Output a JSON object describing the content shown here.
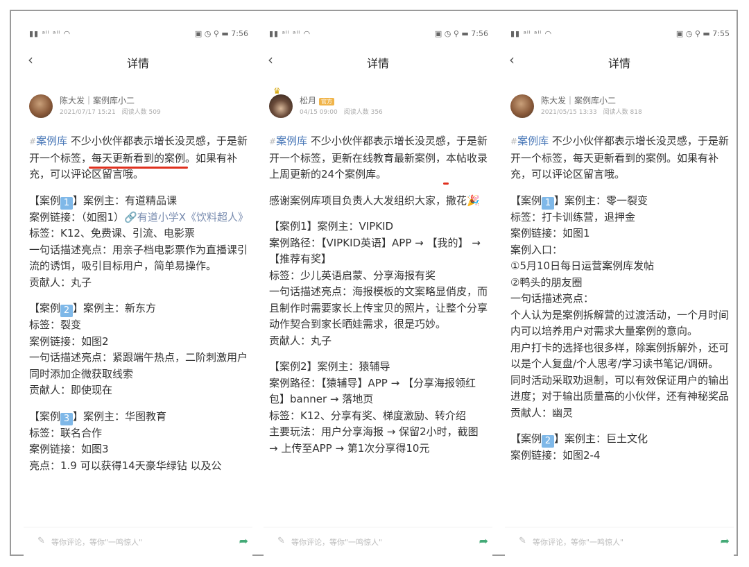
{
  "nav_title": "详情",
  "comment_placeholder": "等你评论，等你\"一鸣惊人\"",
  "panels": [
    {
      "status_time": "7:56",
      "author_name": "陈大发｜案例库小二",
      "author_meta": "2021/07/17 15:21　阅读人数 509",
      "intro_prefix": "案例库",
      "intro_a": "不少小伙伴都表示增长没灵感，",
      "intro_b": "于是新开一个标签，",
      "intro_hl": "每天更新看到的案例",
      "intro_c": "。",
      "intro_d": "如果有补充，可以评论区留言哦。",
      "case1_head": "】案例主：有道精品课",
      "case1_link_label": "案例链接：（如图1）",
      "case1_link": "有道小学X《饮料超人》",
      "case1_tags": "标签：K12、免费课、引流、电影票",
      "case1_desc": "一句话描述亮点：用亲子档电影票作为直播课引流的诱饵，吸引目标用户，简单易操作。",
      "case1_contrib": "贡献人：丸子",
      "case2_head": "】案例主：新东方",
      "case2_tags": "标签：裂变",
      "case2_link": "案例链接：如图2",
      "case2_desc": "一句话描述亮点：紧跟端午热点，二阶刺激用户同时添加企微获取线索",
      "case2_contrib": "贡献人：即使现在",
      "case3_head": "】案例主：华图教育",
      "case3_tags": "标签：联名合作",
      "case3_link": "案例链接：如图3",
      "case3_desc": "亮点：1.9 可以获得14天豪华绿钻 以及公"
    },
    {
      "status_time": "7:56",
      "author_name": "松月",
      "author_tag": "官方",
      "author_meta": "04/15 09:00　阅读人数 356",
      "intro_prefix": "案例库",
      "intro_a": "不少小伙伴都表示增长没灵感，",
      "intro_b": "于是新开一个标签，更新在线教育最新案例，",
      "intro_hl": "本帖收录上周更新的24个案例库",
      "intro_c": "。",
      "thanks": "感谢案例库项目负责人大发组织大家，撒花🎉",
      "case1_head": "【案例1】案例主：VIPKID",
      "case1_path": "案例路径：【VIPKID英语】APP → 【我的】 → 【推荐有奖】",
      "case1_tags": "标签：少儿英语启蒙、分享海报有奖",
      "case1_desc": "一句话描述亮点：海报模板的文案略显俏皮，而且制作时需要家长上传宝贝的照片，让整个分享动作契合到家长晒娃需求，很是巧妙。",
      "case1_contrib": "贡献人：丸子",
      "case2_head": "【案例2】案例主：猿辅导",
      "case2_path": "案例路径：【猿辅导】APP → 【分享海报领红包】banner → 落地页",
      "case2_tags": "标签：K12、分享有奖、梯度激励、转介绍",
      "case2_play": "主要玩法：用户分享海报 → 保留2小时，截图 → 上传至APP → 第1次分享得10元"
    },
    {
      "status_time": "7:55",
      "author_name": "陈大发｜案例库小二",
      "author_meta": "2021/05/15 13:33　阅读人数 818",
      "intro_prefix": "案例库",
      "intro_a": "不少小伙伴都表示增长没灵感，",
      "intro_b": "于是新开一个标签，每天更新看到的案例。",
      "intro_d": "如果有补充，可以评论区留言哦。",
      "case1_head": "】案例主：零一裂变",
      "case1_tags": "标签：打卡训练营，退押金",
      "case1_link": "案例链接：如图1",
      "case1_entry": "案例入口：",
      "case1_e1": "①5月10日每日运营案例库发帖",
      "case1_e2": "②鸭头的朋友圈",
      "case1_desc_head": "一句话描述亮点：",
      "case1_desc": "个人认为是案例拆解营的过渡活动，一个月时间内可以培养用户对需求大量案例的意向。",
      "case1_desc2": "用户打卡的选择也很多样，除案例拆解外，还可以是个人复盘/个人思考/学习读书笔记/调研。",
      "case1_desc3": "同时活动采取劝退制，可以有效保证用户的输出进度；对于输出质量高的小伙伴，还有神秘奖品",
      "case1_contrib": "贡献人：幽灵",
      "case2_head": "】案例主：巨土文化",
      "case2_link": "案例链接：如图2-4"
    }
  ],
  "case_label": "【案例",
  "num1": "1",
  "num2": "2",
  "num3": "3"
}
